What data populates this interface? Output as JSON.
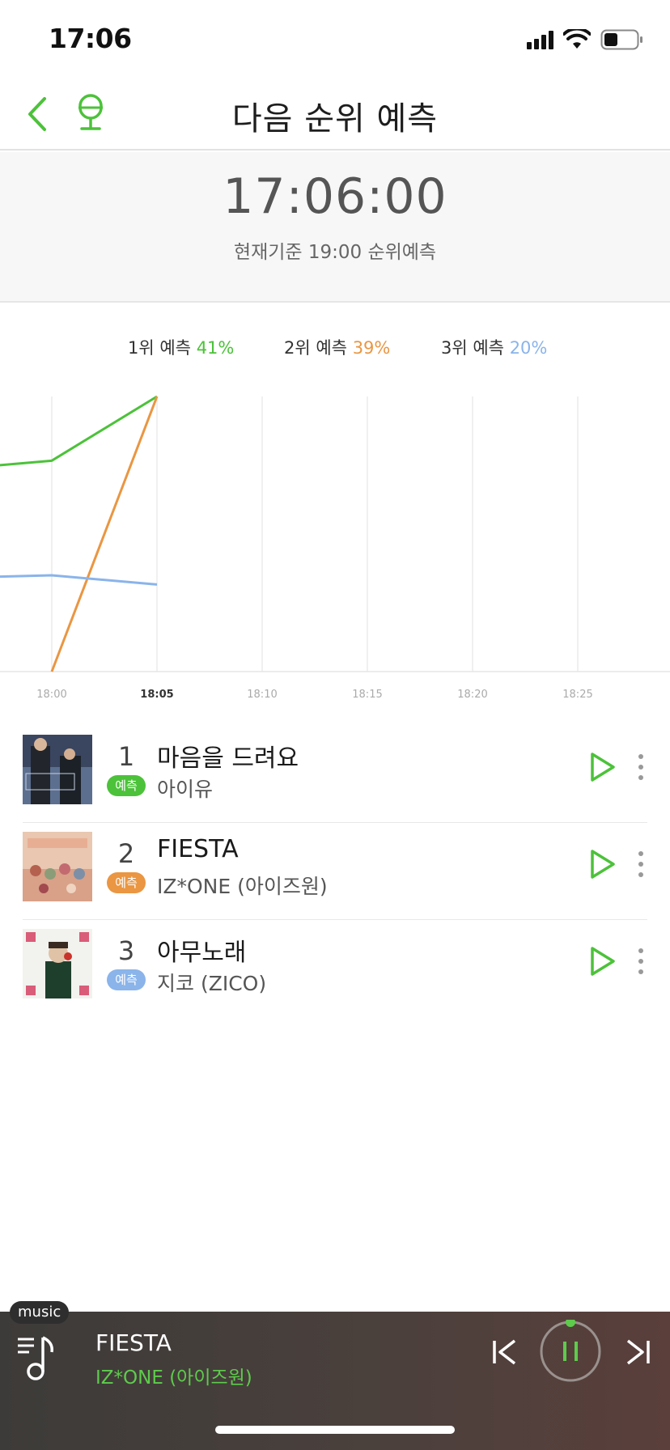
{
  "status_bar": {
    "time": "17:06"
  },
  "nav": {
    "title": "다음 순위 예측"
  },
  "clock": {
    "time": "17:06:00",
    "subtitle": "현재기준 19:00 순위예측"
  },
  "legend": [
    {
      "label": "1위 예측",
      "pct": "41%",
      "color": "#4cc23a"
    },
    {
      "label": "2위 예측",
      "pct": "39%",
      "color": "#ea9642"
    },
    {
      "label": "3위 예측",
      "pct": "20%",
      "color": "#8ab4ea"
    }
  ],
  "chart_data": {
    "type": "line",
    "x": [
      "18:00",
      "18:05",
      "18:10",
      "18:15",
      "18:20",
      "18:25"
    ],
    "highlight_x": "18:05",
    "series": [
      {
        "name": "1위 예측",
        "color": "#4cc23a",
        "points": [
          [
            -5,
            33
          ],
          [
            0,
            34
          ],
          [
            5,
            41
          ]
        ]
      },
      {
        "name": "2위 예측",
        "color": "#ea9642",
        "points": [
          [
            0,
            11
          ],
          [
            5,
            41
          ]
        ]
      },
      {
        "name": "3위 예측",
        "color": "#8ab4ea",
        "points": [
          [
            -5,
            21.2
          ],
          [
            0,
            21.5
          ],
          [
            5,
            20.5
          ]
        ]
      }
    ],
    "grid": true
  },
  "tracks": [
    {
      "rank": "1",
      "badge": "예측",
      "badge_color": "#4cc23a",
      "title": "마음을 드려요",
      "artist": "아이유"
    },
    {
      "rank": "2",
      "badge": "예측",
      "badge_color": "#ea9642",
      "title": "FIESTA",
      "artist": "IZ*ONE (아이즈원)"
    },
    {
      "rank": "3",
      "badge": "예측",
      "badge_color": "#8ab4ea",
      "title": "아무노래",
      "artist": "지코 (ZICO)"
    }
  ],
  "player": {
    "tag": "music",
    "title": "FIESTA",
    "artist": "IZ*ONE (아이즈원)",
    "playing": true
  },
  "icons": {
    "back": "chevron-left-icon",
    "mic": "mic-icon",
    "play": "play-icon",
    "more": "more-vertical-icon",
    "playlist": "playlist-icon",
    "prev": "previous-icon",
    "pause": "pause-icon",
    "next": "next-icon"
  },
  "accent_color": "#4cc23a"
}
